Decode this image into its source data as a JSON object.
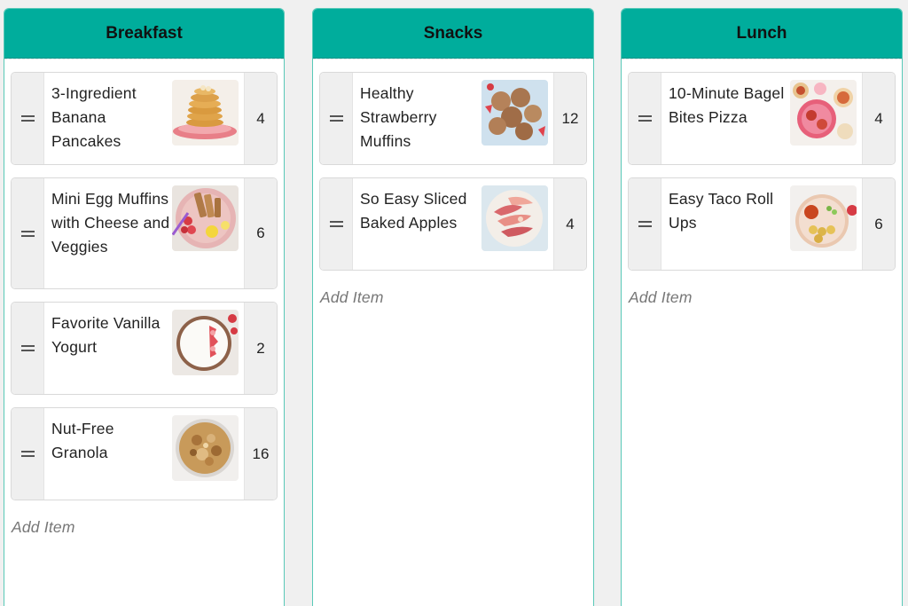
{
  "columns": [
    {
      "title": "Breakfast",
      "add_label": "Add Item",
      "items": [
        {
          "title": "3-Ingredient Banana Pancakes",
          "qty": "4",
          "image": "pancake-stack-image"
        },
        {
          "title": "Mini Egg Muffins with Cheese and Veggies",
          "qty": "6",
          "image": "egg-muffins-plate-image"
        },
        {
          "title": "Favorite Vanilla Yogurt",
          "qty": "2",
          "image": "yogurt-bowl-image"
        },
        {
          "title": "Nut-Free Granola",
          "qty": "16",
          "image": "granola-jar-image"
        }
      ]
    },
    {
      "title": "Snacks",
      "add_label": "Add Item",
      "items": [
        {
          "title": "Healthy Strawberry Muffins",
          "qty": "12",
          "image": "strawberry-muffins-image"
        },
        {
          "title": "So Easy Sliced Baked Apples",
          "qty": "4",
          "image": "baked-apples-image"
        }
      ]
    },
    {
      "title": "Lunch",
      "add_label": "Add Item",
      "items": [
        {
          "title": "10-Minute Bagel Bites Pizza",
          "qty": "4",
          "image": "bagel-bites-image"
        },
        {
          "title": "Easy Taco Roll Ups",
          "qty": "6",
          "image": "taco-roll-ups-image"
        }
      ]
    }
  ],
  "colors": {
    "header": "#00ad9c",
    "column_border": "#58c9b8",
    "background": "#f0f0f0"
  }
}
